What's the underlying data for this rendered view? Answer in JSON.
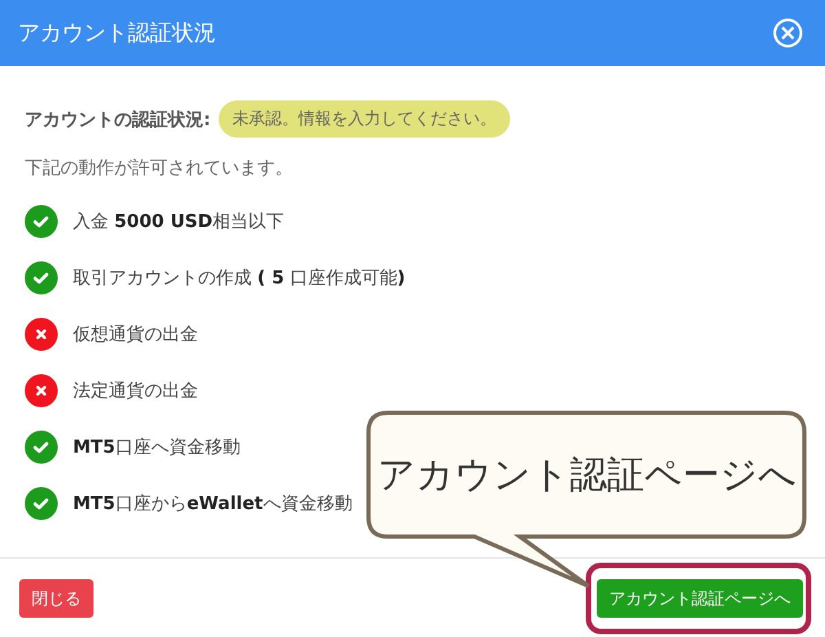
{
  "window": {
    "title": "アカウント認証状況"
  },
  "status": {
    "label": "アカウントの認証状況:",
    "badge": "未承認。情報を入力してください。"
  },
  "description": "下記の動作が許可されています。",
  "permissions": [
    {
      "kind": "allowed",
      "text": "入金 **5000 USD**相当以下"
    },
    {
      "kind": "allowed",
      "text": "取引アカウントの作成 **( 5** 口座作成可能**)**"
    },
    {
      "kind": "denied",
      "text": "仮想通貨の出金"
    },
    {
      "kind": "denied",
      "text": "法定通貨の出金"
    },
    {
      "kind": "allowed",
      "text": "**MT5**口座へ資金移動"
    },
    {
      "kind": "allowed",
      "text": "**MT5**口座から**eWallet**へ資金移動"
    }
  ],
  "buttons": [
    {
      "kind": "close",
      "label": "閉じる"
    },
    {
      "kind": "primary",
      "label": "アカウント認証ページへ"
    }
  ],
  "callout": {
    "text": "アカウント認証ページへ"
  }
}
